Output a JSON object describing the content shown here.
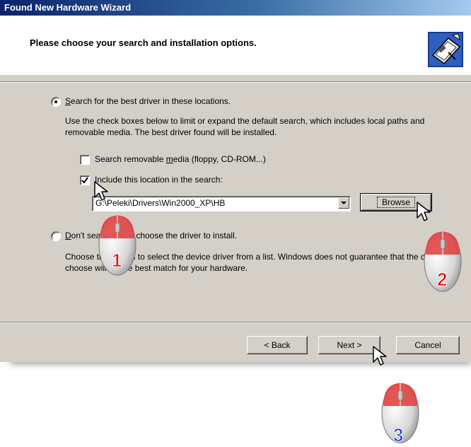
{
  "window": {
    "title": "Found New Hardware Wizard"
  },
  "header": {
    "title": "Please choose your search and installation options."
  },
  "options": {
    "search_radio": {
      "prefix": "",
      "mnemonic": "S",
      "rest": "earch for the best driver in these locations.",
      "selected": true
    },
    "search_description": "Use the check boxes below to limit or expand the default search, which includes local paths and removable media. The best driver found will be installed.",
    "removable_media": {
      "prefix": "Search removable ",
      "mnemonic": "m",
      "rest": "edia (floppy, CD-ROM...)",
      "checked": false
    },
    "include_location": {
      "prefix": "I",
      "mnemonic": "n",
      "rest": "clude this location in the search:",
      "checked": true,
      "prefix_raw": "",
      "full": "Include this location in the search:"
    },
    "path_value": "G:\\Peleki\\Drivers\\Win2000_XP\\HB",
    "browse_label": "Browse",
    "dont_search_radio": {
      "mnemonic": "D",
      "rest": "on't search. I will choose the driver to install.",
      "selected": false
    },
    "dont_search_description": "Choose this option to select the device driver from a list. Windows does not guarantee that the driver you choose will be the best match for your hardware."
  },
  "footer": {
    "back_label": "< Back",
    "next_label": "Next >",
    "cancel_label": "Cancel"
  },
  "annotations": {
    "step1": "1",
    "step2": "2",
    "step3": "3",
    "step1_color": "#e00000",
    "step2_color": "#e00000",
    "step3_color": "#1a3fd0"
  },
  "colors": {
    "title_gradient_start": "#0a246a",
    "dialog_face": "#d4d0c8"
  }
}
